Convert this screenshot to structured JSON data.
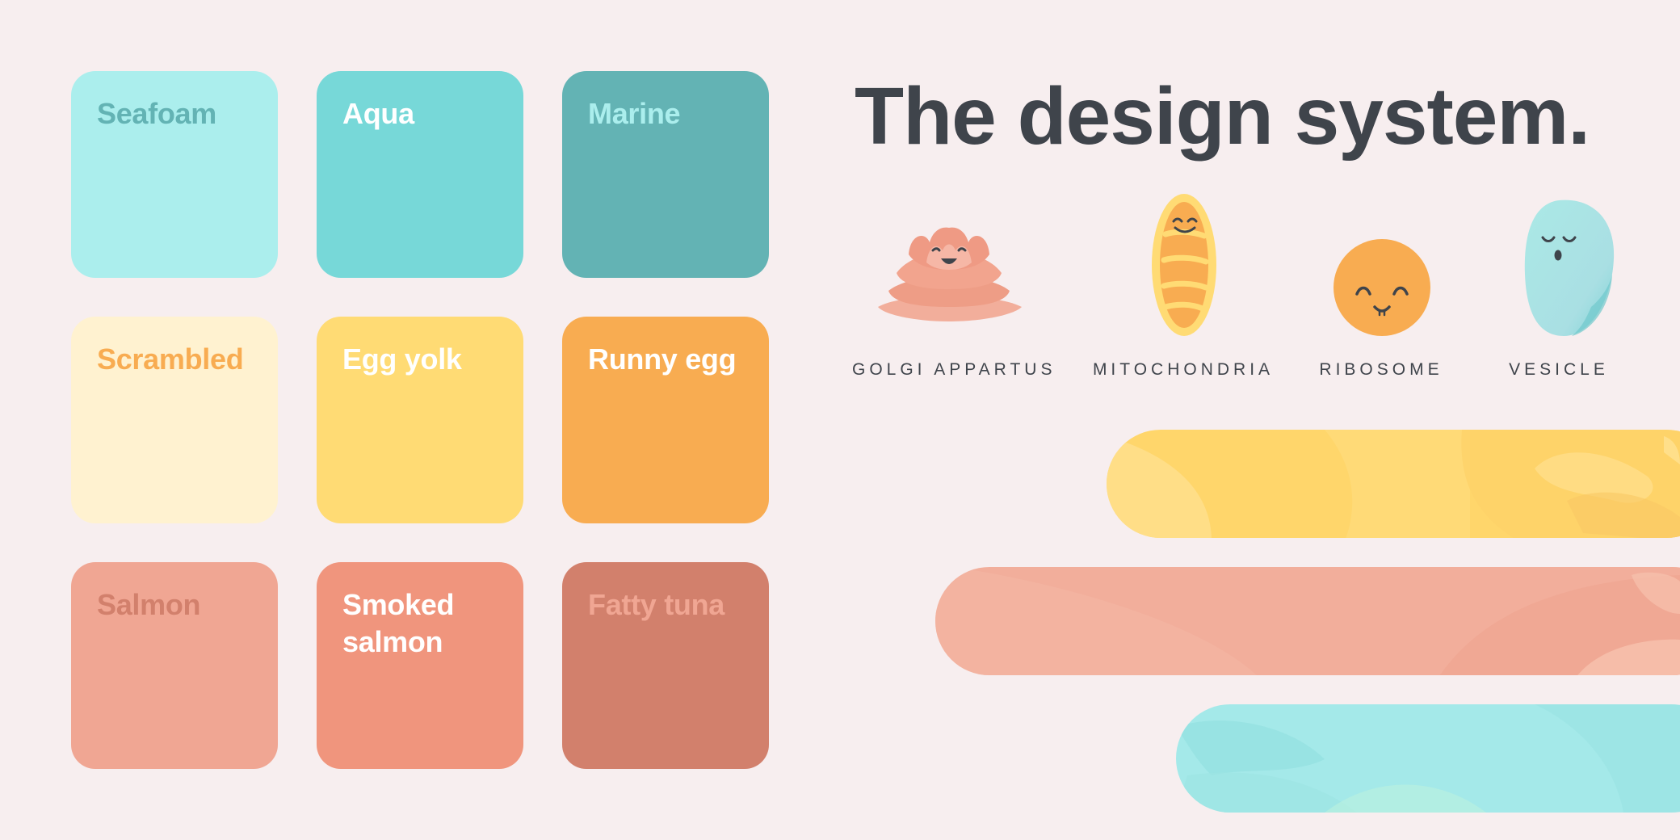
{
  "headline": "The design system.",
  "swatches": [
    {
      "name": "Seafoam",
      "color": "#abeeed",
      "text_color": "#63b3b4"
    },
    {
      "name": "Aqua",
      "color": "#77d8d8",
      "text_color": "#ffffff"
    },
    {
      "name": "Marine",
      "color": "#63b3b4",
      "text_color": "#abeeed"
    },
    {
      "name": "Scrambled",
      "color": "#fff2d0",
      "text_color": "#f8ac51"
    },
    {
      "name": "Egg yolk",
      "color": "#ffdb74",
      "text_color": "#ffffff"
    },
    {
      "name": "Runny egg",
      "color": "#f8ac51",
      "text_color": "#ffffff"
    },
    {
      "name": "Salmon",
      "color": "#f0a693",
      "text_color": "#d2806c"
    },
    {
      "name": "Smoked\nsalmon",
      "color": "#f0957d",
      "text_color": "#ffffff"
    },
    {
      "name": "Fatty tuna",
      "color": "#d2806c",
      "text_color": "#f0a693"
    }
  ],
  "organelles": [
    {
      "name": "GOLGI APPARTUS",
      "icon": "golgi-icon"
    },
    {
      "name": "MITOCHONDRIA",
      "icon": "mitochondria-icon"
    },
    {
      "name": "RIBOSOME",
      "icon": "ribosome-icon"
    },
    {
      "name": "VESICLE",
      "icon": "vesicle-icon"
    }
  ],
  "colors": {
    "background": "#f7eeef",
    "headline": "#3f444b",
    "ribbon_yellow": "#ffd66b",
    "ribbon_pink": "#f2ae9b",
    "ribbon_aqua": "#a4e9e9"
  }
}
